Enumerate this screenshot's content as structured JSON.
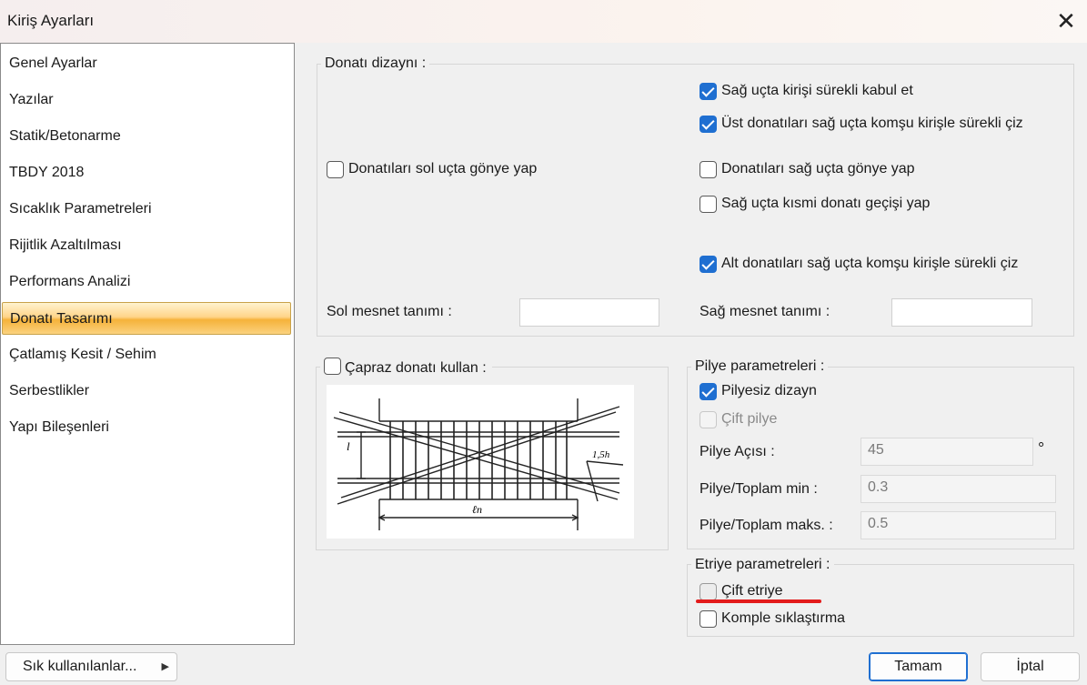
{
  "window": {
    "title": "Kiriş Ayarları",
    "close_glyph": "✕"
  },
  "sidebar": {
    "items": [
      {
        "label": "Genel Ayarlar"
      },
      {
        "label": "Yazılar"
      },
      {
        "label": "Statik/Betonarme"
      },
      {
        "label": "TBDY 2018"
      },
      {
        "label": "Sıcaklık Parametreleri"
      },
      {
        "label": "Rijitlik Azaltılması"
      },
      {
        "label": "Performans Analizi"
      },
      {
        "label": "Donatı Tasarımı"
      },
      {
        "label": "Çatlamış Kesit / Sehim"
      },
      {
        "label": "Serbestlikler"
      },
      {
        "label": "Yapı Bileşenleri"
      }
    ],
    "selected": "Donatı Tasarımı"
  },
  "donati_dizayni": {
    "group_label": "Donatı dizaynı :",
    "sag_surekli": {
      "label": "Sağ uçta kirişi sürekli kabul et",
      "checked": true
    },
    "ust_sag_surekli": {
      "label": "Üst donatıları sağ uçta komşu kirişle sürekli çiz",
      "checked": true
    },
    "sol_gonye": {
      "label": "Donatıları sol uçta gönye yap",
      "checked": false
    },
    "sag_gonye": {
      "label": "Donatıları sağ uçta gönye yap",
      "checked": false
    },
    "sag_kismi": {
      "label": "Sağ uçta kısmi donatı geçişi yap",
      "checked": false
    },
    "alt_sag_surekli": {
      "label": "Alt donatıları sağ uçta komşu kirişle sürekli çiz",
      "checked": true
    },
    "sol_mesnet_label": "Sol mesnet tanımı :",
    "sol_mesnet_value": "",
    "sag_mesnet_label": "Sağ mesnet tanımı :",
    "sag_mesnet_value": ""
  },
  "capraz": {
    "label": "Çapraz donatı kullan :",
    "checked": false,
    "figure_labels": {
      "l": "l",
      "dim": "1,5h",
      "ln": "ℓn"
    }
  },
  "pilye": {
    "group_label": "Pilye parametreleri :",
    "pilyesiz": {
      "label": "Pilyesiz dizayn",
      "checked": true
    },
    "cift_pilye": {
      "label": "Çift pilye",
      "checked": false,
      "enabled": false
    },
    "aci_label": "Pilye Açısı :",
    "aci_value": "45",
    "aci_unit": "°",
    "min_label": "Pilye/Toplam min :",
    "min_value": "0.3",
    "maks_label": "Pilye/Toplam maks. :",
    "maks_value": "0.5"
  },
  "etriye": {
    "group_label": "Etriye parametreleri :",
    "cift_etriye": {
      "label": "Çift etriye",
      "checked": false
    },
    "komple": {
      "label": "Komple sıklaştırma",
      "checked": false
    },
    "annotation_color": "#e31b1b"
  },
  "footer": {
    "favorites_label": "Sık kullanılanlar...",
    "favorites_arrow": "▶",
    "ok_label": "Tamam",
    "cancel_label": "İptal"
  },
  "colors": {
    "accent": "#1f6fd1",
    "selection": "#f5b23a"
  }
}
